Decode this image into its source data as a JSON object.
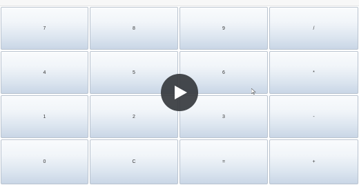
{
  "keypad": {
    "rows": [
      [
        "7",
        "8",
        "9",
        "/"
      ],
      [
        "4",
        "5",
        "6",
        "*"
      ],
      [
        "1",
        "2",
        "3",
        "-"
      ],
      [
        "0",
        "C",
        "=",
        "+"
      ]
    ]
  },
  "overlay": {
    "icon": "play-icon"
  },
  "colors": {
    "key_top": "#f9fbfd",
    "key_bottom": "#c9d6e6",
    "key_border": "#b9c3cf",
    "overlay_bg": "#363a3e"
  }
}
